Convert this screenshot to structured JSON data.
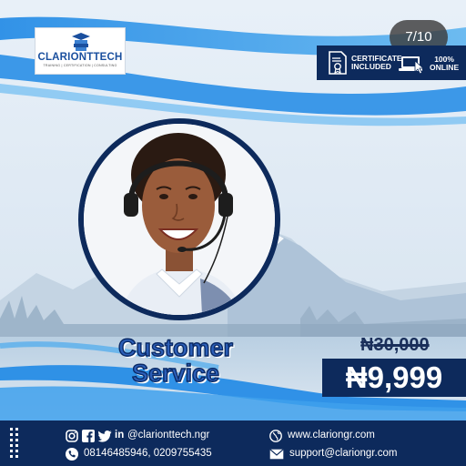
{
  "logo": {
    "brand": "CLARIONTTECH",
    "tagline": "TRAINING | CERTIFICATION | CONSULTING"
  },
  "counter": "7/10",
  "badges": {
    "certificate": [
      "CERTIFICATE",
      "INCLUDED"
    ],
    "online": [
      "100%",
      "ONLINE"
    ]
  },
  "course": {
    "title_line1": "Customer",
    "title_line2": "Service"
  },
  "price": {
    "old_symbol": "₦",
    "old_amount": "30,000",
    "new": "₦9,999"
  },
  "footer": {
    "social_handle": "@clarionttech.ngr",
    "phones": "08146485946, 0209755435",
    "website": "www.clariongr.com",
    "email": "support@clariongr.com",
    "social_in": "in"
  },
  "colors": {
    "navy": "#0d2a5c",
    "accent_blue": "#1e88e5",
    "title_blue": "#2c5fb8"
  }
}
